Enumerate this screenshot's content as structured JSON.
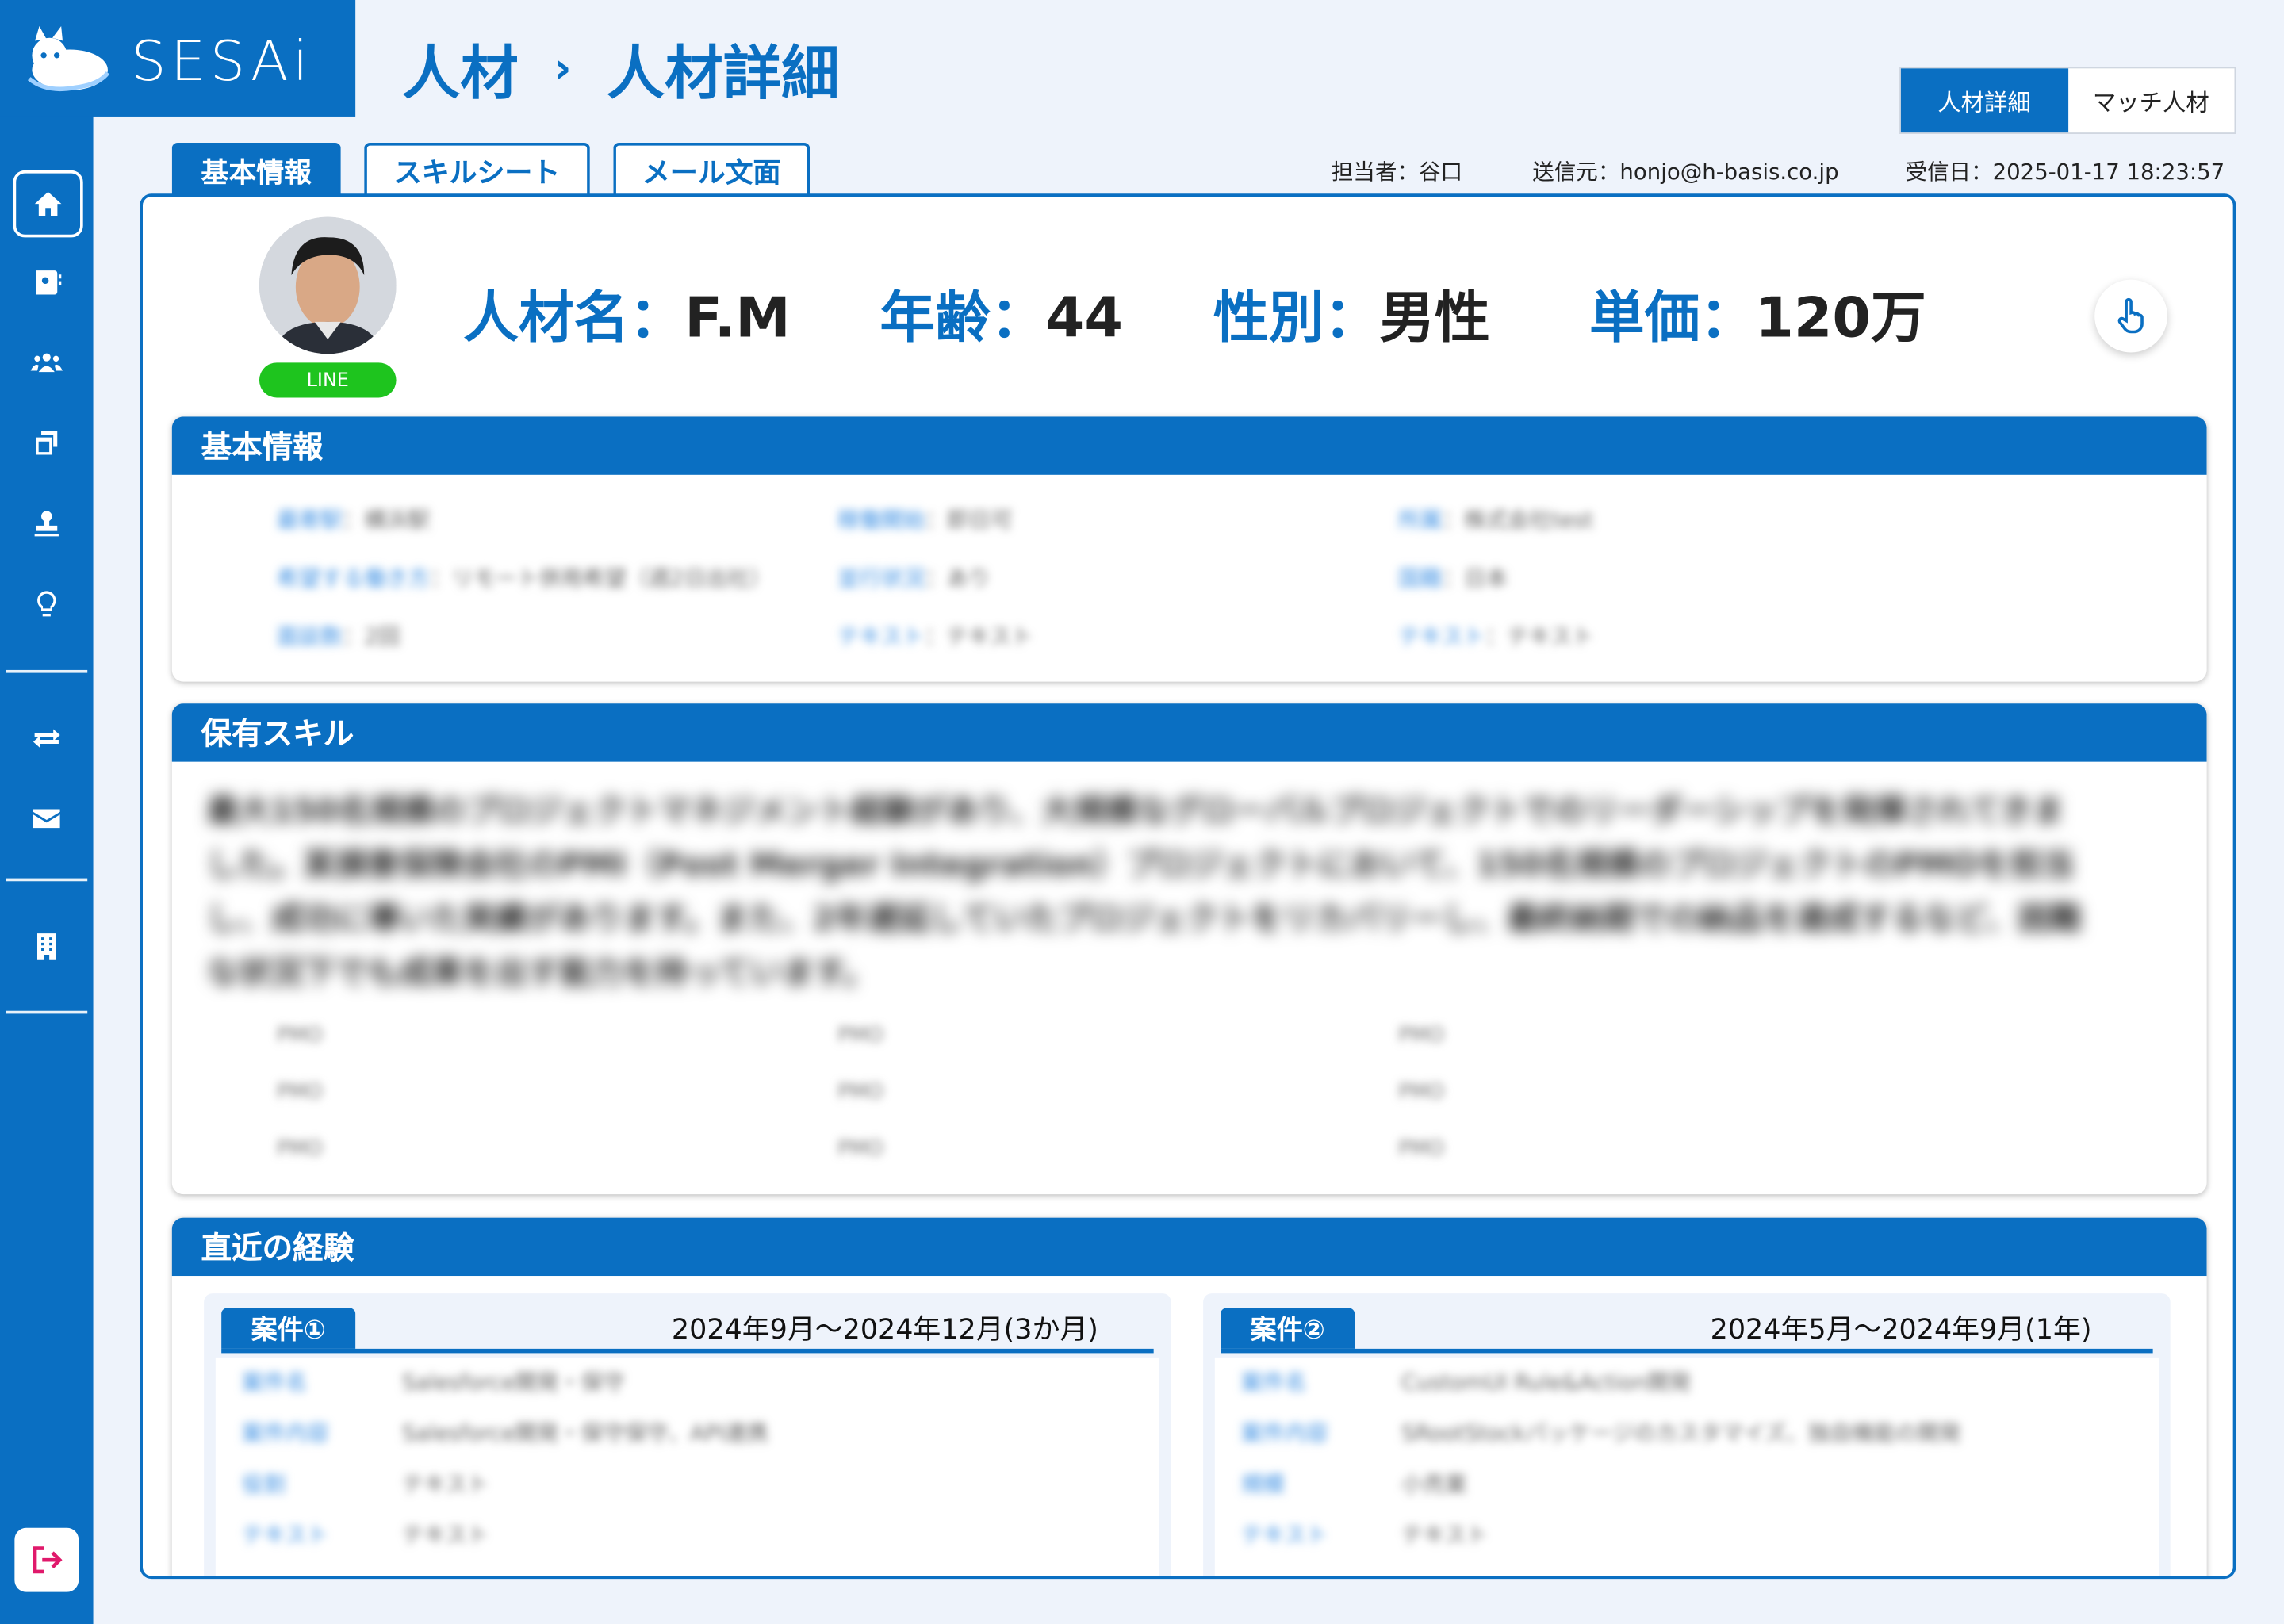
{
  "brand": {
    "logo": "SESAi"
  },
  "breadcrumb": {
    "parent": "人材",
    "separator": "›",
    "current": "人材詳細"
  },
  "view_toggle": {
    "active": "人材詳細",
    "other": "マッチ人材"
  },
  "tabs": [
    "基本情報",
    "スキルシート",
    "メール文面"
  ],
  "meta": {
    "owner": "担当者：谷口",
    "sender": "送信元：honjo@h-basis.co.jp",
    "received": "受信日：2025-01-17 18:23:57"
  },
  "profile": {
    "badge": "LINE",
    "name_label": "人材名：",
    "name_value": "F.M",
    "age_label": "年齢：",
    "age_value": "44",
    "gender_label": "性別：",
    "gender_value": "男性",
    "price_label": "単価：",
    "price_value": "120万"
  },
  "basic_info": {
    "title": "基本情報",
    "rows": [
      [
        {
          "k": "最寄駅",
          "v": "：横浜駅"
        },
        {
          "k": "稼働開始",
          "v": "：即日可"
        },
        {
          "k": "所属",
          "v": "：株式会社test"
        }
      ],
      [
        {
          "k": "希望する働き方",
          "v": "：リモート併用希望（週2日出社）"
        },
        {
          "k": "並行状況",
          "v": "：あり"
        },
        {
          "k": "国籍",
          "v": "：日本"
        }
      ],
      [
        {
          "k": "面談数",
          "v": "：2回"
        },
        {
          "k": "テキスト",
          "v": "：テキスト"
        },
        {
          "k": "テキスト",
          "v": "：テキスト"
        }
      ]
    ]
  },
  "skills": {
    "title": "保有スキル",
    "summary": "最大150名規模のプロジェクトマネジメント経験があり、大規模なグローバルプロジェクトでのリーダーシップを発揮されてきました。某損害保険会社のPMI（Post Merger Integration）プロジェクトにおいて、150名規模のプロジェクトのPMOを担当し、成功に導いた実績があります。また、2年遅延していたプロジェクトをリカバリーし、最終納期での納品を達成するなど、困難な状況下でも成果を出す能力を持っています。",
    "items": [
      "PMO",
      "PMO",
      "PMO",
      "PMO",
      "PMO",
      "PMO",
      "PMO",
      "PMO",
      "PMO"
    ]
  },
  "experience": {
    "title": "直近の経験",
    "projects": [
      {
        "tag": "案件①",
        "period": "2024年9月～2024年12月(3か月)",
        "rows": [
          {
            "k": "案件名",
            "v": "Salesforce開発・保守"
          },
          {
            "k": "案件内容",
            "v": "Salesforce開発・保守保守、API連携"
          },
          {
            "k": "役割",
            "v": "テキスト"
          },
          {
            "k": "テキスト",
            "v": "テキスト"
          }
        ]
      },
      {
        "tag": "案件②",
        "period": "2024年5月～2024年9月(1年)",
        "rows": [
          {
            "k": "案件名",
            "v": "CustomUI Rule&Action開発"
          },
          {
            "k": "案件内容",
            "v": "SRootStockパッケージのカスタマイズ、独自機能の開発"
          },
          {
            "k": "規模",
            "v": "小売業"
          },
          {
            "k": "テキスト",
            "v": "テキスト"
          }
        ]
      }
    ]
  },
  "icons": [
    "home-icon",
    "contact-card-icon",
    "users-icon",
    "copy-icon",
    "stamp-icon",
    "lightbulb-icon",
    "swap-icon",
    "mail-icon",
    "building-icon",
    "logout-icon",
    "pointing-hand-icon"
  ],
  "colors": {
    "primary": "#0a6fc2",
    "line_green": "#1ec41e",
    "logout": "#e0196b"
  }
}
